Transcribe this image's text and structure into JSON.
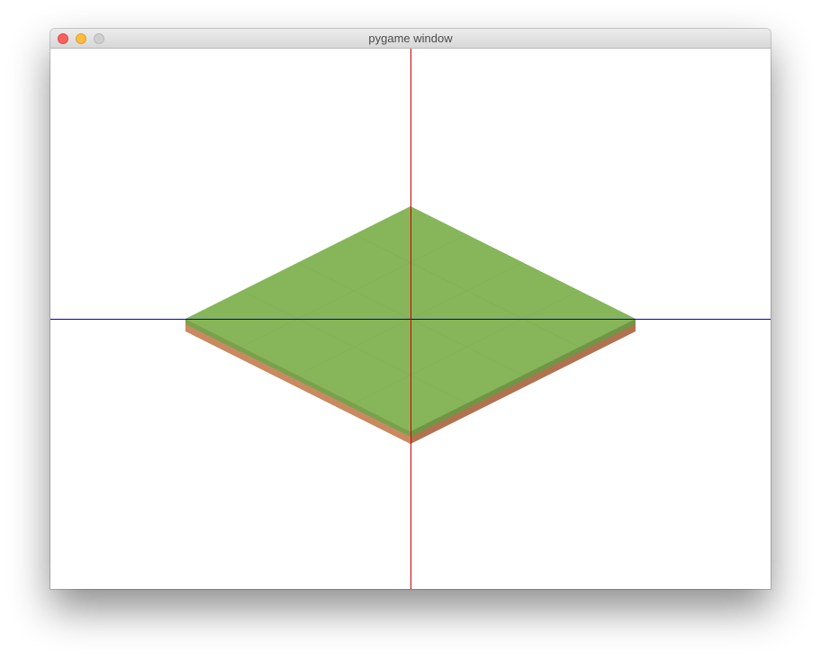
{
  "window": {
    "title": "pygame window",
    "controls": {
      "close_color": "#fc605c",
      "minimize_color": "#fdbc40",
      "zoom_color": "#cfcfcf"
    }
  },
  "scene": {
    "background": "#ffffff",
    "axes": {
      "vertical_color": "#cc0000",
      "horizontal_color": "#0000cc"
    },
    "tile": {
      "top_color": "#86b55a",
      "grid_color": "#7aa851",
      "left_edge_grass": "#78a24c",
      "right_edge_grass": "#6e9644",
      "left_side_dirt": "#c98a62",
      "right_side_dirt": "#b0724f"
    }
  }
}
